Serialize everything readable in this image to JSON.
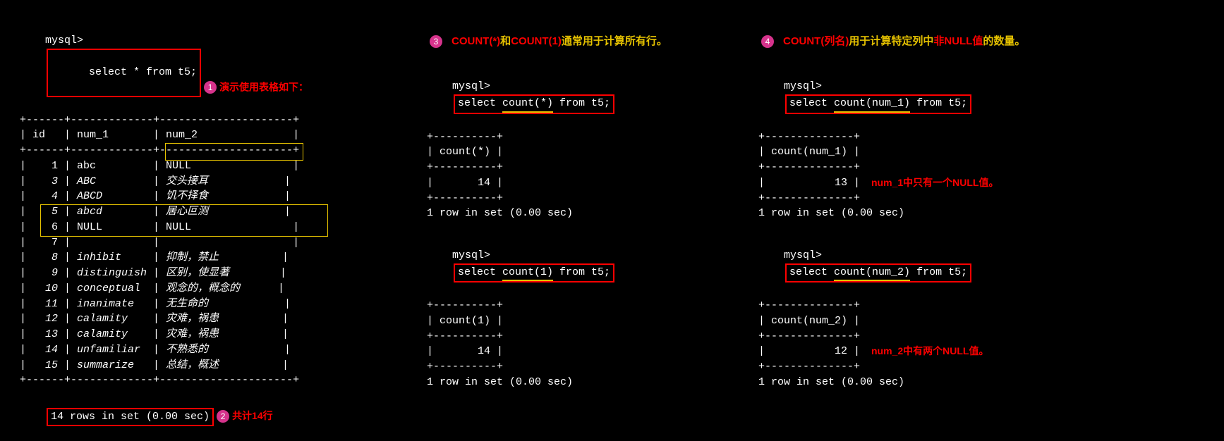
{
  "col1": {
    "prompt": "mysql>",
    "query": "select * from t5;",
    "bullet": "1",
    "caption": "演示使用表格如下：",
    "hr": "+------+-------------+---------------------+",
    "hdr": "| id   | num_1       | num_2               |",
    "rows": [
      "|    1 | abc         | NULL                |",
      "|    3 | ABC         | 交头接耳            |",
      "|    4 | ABCD        | 饥不择食            |",
      "|    5 | abcd        | 居心叵测            |",
      "|    6 | NULL        | NULL                |",
      "|    7 |             |                     |",
      "|    8 | inhibit     | 抑制，禁止          |",
      "|    9 | distinguish | 区别，使显著        |",
      "|   10 | conceptual  | 观念的，概念的      |",
      "|   11 | inanimate   | 无生命的            |",
      "|   12 | calamity    | 灾难，祸患          |",
      "|   13 | calamity    | 灾难，祸患          |",
      "|   14 | unfamiliar  | 不熟悉的            |",
      "|   15 | summarize   | 总结，概述          |"
    ],
    "footer_text": "14 rows in set (0.00 sec)",
    "bullet2": "2",
    "footer_caption": "共计14行"
  },
  "col2": {
    "bullet": "3",
    "caption_p1": "COUNT(*)",
    "caption_p2": "和",
    "caption_p3": "COUNT(1)",
    "caption_p4": "通常用于计算所有行。",
    "q1": {
      "prompt": "mysql>",
      "pre": "select ",
      "u": "count(*)",
      "post": " from t5;",
      "hr": "+----------+",
      "hdr": "| count(*) |",
      "val": "|       14 |",
      "foot": "1 row in set (0.00 sec)"
    },
    "q2": {
      "prompt": "mysql>",
      "pre": "select ",
      "u": "count(1)",
      "post": " from t5;",
      "hr": "+----------+",
      "hdr": "| count(1) |",
      "val": "|       14 |",
      "foot": "1 row in set (0.00 sec)"
    }
  },
  "col3": {
    "bullet": "4",
    "cap_p1": "COUNT(列名)",
    "cap_p2": "用于计算特定列中",
    "cap_p3": "非NULL值",
    "cap_p4": "的数量。",
    "q1": {
      "prompt": "mysql>",
      "pre": "select ",
      "u": "count(num_1)",
      "post": " from t5;",
      "hr": "+--------------+",
      "hdr": "| count(num_1) |",
      "val": "|           13 |",
      "foot": "1 row in set (0.00 sec)",
      "note": "num_1中只有一个NULL值。"
    },
    "q2": {
      "prompt": "mysql>",
      "pre": "select ",
      "u": "count(num_2)",
      "post": " from t5;",
      "hr": "+--------------+",
      "hdr": "| count(num_2) |",
      "val": "|           12 |",
      "foot": "1 row in set (0.00 sec)",
      "note": "num_2中有两个NULL值。"
    }
  }
}
